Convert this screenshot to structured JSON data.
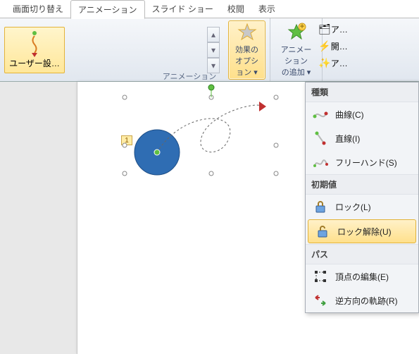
{
  "tabs": {
    "t1": "画面切り替え",
    "t2": "アニメーション",
    "t3": "スライド ショー",
    "t4": "校閲",
    "t5": "表示"
  },
  "ribbon": {
    "gallery_label": "アニメーション",
    "user_settings": "ユーザー設…",
    "effect_options": "効果の\nオプション ▾",
    "add_animation": "アニメーション\nの追加 ▾",
    "p1": "ア…",
    "p2": "開…",
    "p3": "ア…"
  },
  "badge": "1",
  "menu": {
    "h1": "種類",
    "curve": "曲線(C)",
    "line": "直線(I)",
    "freehand": "フリーハンド(S)",
    "h2": "初期値",
    "lock": "ロック(L)",
    "unlock": "ロック解除(U)",
    "h3": "パス",
    "edit_points": "頂点の編集(E)",
    "reverse": "逆方向の軌跡(R)"
  }
}
